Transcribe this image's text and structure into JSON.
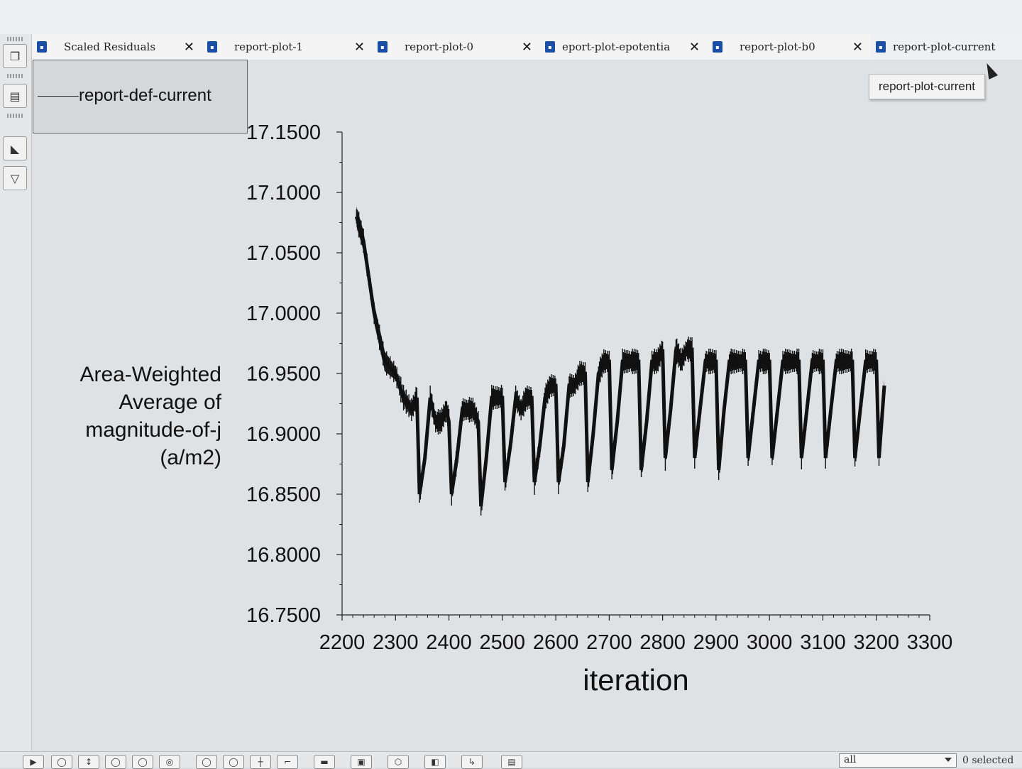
{
  "tabs": [
    {
      "label": "Scaled Residuals",
      "active": false
    },
    {
      "label": "report-plot-1",
      "active": false
    },
    {
      "label": "report-plot-0",
      "active": false
    },
    {
      "label": "eport-plot-epotentia",
      "active": false
    },
    {
      "label": "report-plot-b0",
      "active": false
    },
    {
      "label": "report-plot-current",
      "active": true
    }
  ],
  "tooltip": "report-plot-current",
  "legend": {
    "label": "report-def-current"
  },
  "ylabel": "Area-Weighted Average of magnitude-of-j (a/m2)",
  "xlabel": "iteration",
  "footer": {
    "filter_value": "all",
    "selected": "0 selected"
  },
  "colors": {
    "series": "#111111",
    "tab_icon": "#1a4fa5"
  },
  "chart_data": {
    "type": "line",
    "xlabel": "iteration",
    "ylabel": "Area-Weighted Average of magnitude-of-j (a/m2)",
    "xlim": [
      2200,
      3300
    ],
    "ylim": [
      16.75,
      17.15
    ],
    "xticks": [
      "2200",
      "2300",
      "2400",
      "2500",
      "2600",
      "2700",
      "2800",
      "2900",
      "3000",
      "3100",
      "3200",
      "3300"
    ],
    "yticks": [
      "16.7500",
      "16.8000",
      "16.8500",
      "16.9000",
      "16.9500",
      "17.0000",
      "17.0500",
      "17.1000",
      "17.1500"
    ],
    "legend": "top-left",
    "series": [
      {
        "name": "report-def-current",
        "x": [
          2227,
          2240,
          2260,
          2280,
          2300,
          2315,
          2330,
          2340,
          2345,
          2355,
          2365,
          2375,
          2385,
          2395,
          2400,
          2405,
          2415,
          2425,
          2435,
          2445,
          2455,
          2460,
          2470,
          2480,
          2490,
          2500,
          2505,
          2515,
          2525,
          2535,
          2545,
          2555,
          2560,
          2570,
          2580,
          2590,
          2600,
          2605,
          2615,
          2625,
          2635,
          2645,
          2655,
          2660,
          2670,
          2680,
          2690,
          2700,
          2705,
          2715,
          2725,
          2735,
          2745,
          2755,
          2760,
          2770,
          2780,
          2790,
          2800,
          2805,
          2815,
          2825,
          2835,
          2845,
          2855,
          2860,
          2870,
          2880,
          2890,
          2900,
          2905,
          2915,
          2925,
          2935,
          2945,
          2955,
          2960,
          2970,
          2980,
          2990,
          3000,
          3005,
          3015,
          3025,
          3035,
          3045,
          3055,
          3060,
          3070,
          3080,
          3090,
          3100,
          3105,
          3115,
          3125,
          3135,
          3145,
          3155,
          3160,
          3170,
          3180,
          3190,
          3200,
          3205,
          3215
        ],
        "y": [
          17.08,
          17.06,
          17.0,
          16.96,
          16.95,
          16.93,
          16.92,
          16.93,
          16.85,
          16.88,
          16.93,
          16.91,
          16.91,
          16.92,
          16.91,
          16.85,
          16.88,
          16.92,
          16.92,
          16.92,
          16.91,
          16.84,
          16.88,
          16.93,
          16.93,
          16.93,
          16.86,
          16.89,
          16.93,
          16.92,
          16.93,
          16.93,
          16.86,
          16.89,
          16.93,
          16.94,
          16.94,
          16.86,
          16.89,
          16.94,
          16.94,
          16.95,
          16.95,
          16.86,
          16.9,
          16.95,
          16.96,
          16.96,
          16.87,
          16.91,
          16.96,
          16.96,
          16.96,
          16.96,
          16.87,
          16.91,
          16.96,
          16.96,
          16.97,
          16.88,
          16.92,
          16.97,
          16.96,
          16.97,
          16.97,
          16.88,
          16.92,
          16.96,
          16.96,
          16.96,
          16.87,
          16.92,
          16.96,
          16.96,
          16.96,
          16.96,
          16.88,
          16.92,
          16.96,
          16.96,
          16.96,
          16.88,
          16.92,
          16.96,
          16.96,
          16.96,
          16.96,
          16.88,
          16.92,
          16.96,
          16.96,
          16.96,
          16.88,
          16.92,
          16.96,
          16.96,
          16.96,
          16.96,
          16.88,
          16.92,
          16.96,
          16.96,
          16.96,
          16.88,
          16.94
        ]
      }
    ]
  }
}
